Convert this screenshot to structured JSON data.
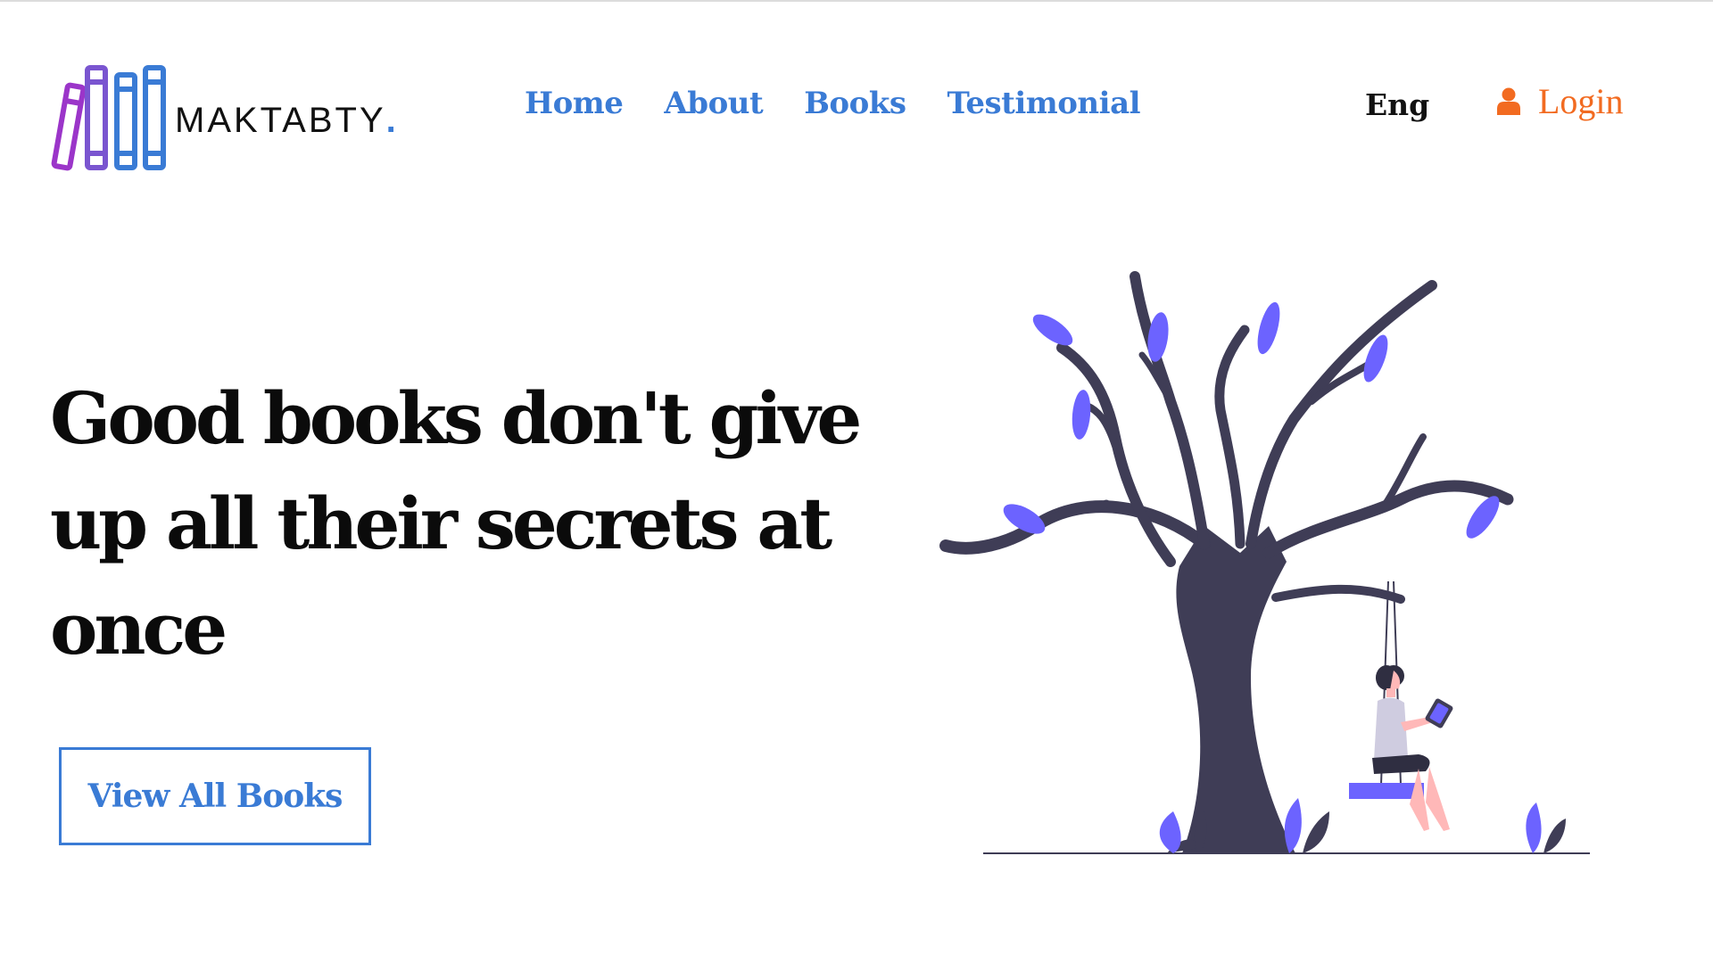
{
  "brand": {
    "name": "MAKTABTY",
    "dot": ".",
    "logo_icon": "books-logo-icon",
    "colors": {
      "purple": "#9b35c9",
      "blue": "#3a7bd5"
    }
  },
  "nav": {
    "items": [
      {
        "label": "Home"
      },
      {
        "label": "About"
      },
      {
        "label": "Books"
      },
      {
        "label": "Testimonial"
      }
    ],
    "color": "#3a7bd5"
  },
  "header": {
    "language": "Eng",
    "login": {
      "label": "Login",
      "icon": "user-icon",
      "color": "#f26b21"
    }
  },
  "hero": {
    "title": "Good books don't give up all their secrets at once",
    "cta_label": "View All Books",
    "illustration": "woman-reading-on-swing-under-tree",
    "colors": {
      "tree": "#3f3d56",
      "leaves": "#6c63ff"
    }
  }
}
